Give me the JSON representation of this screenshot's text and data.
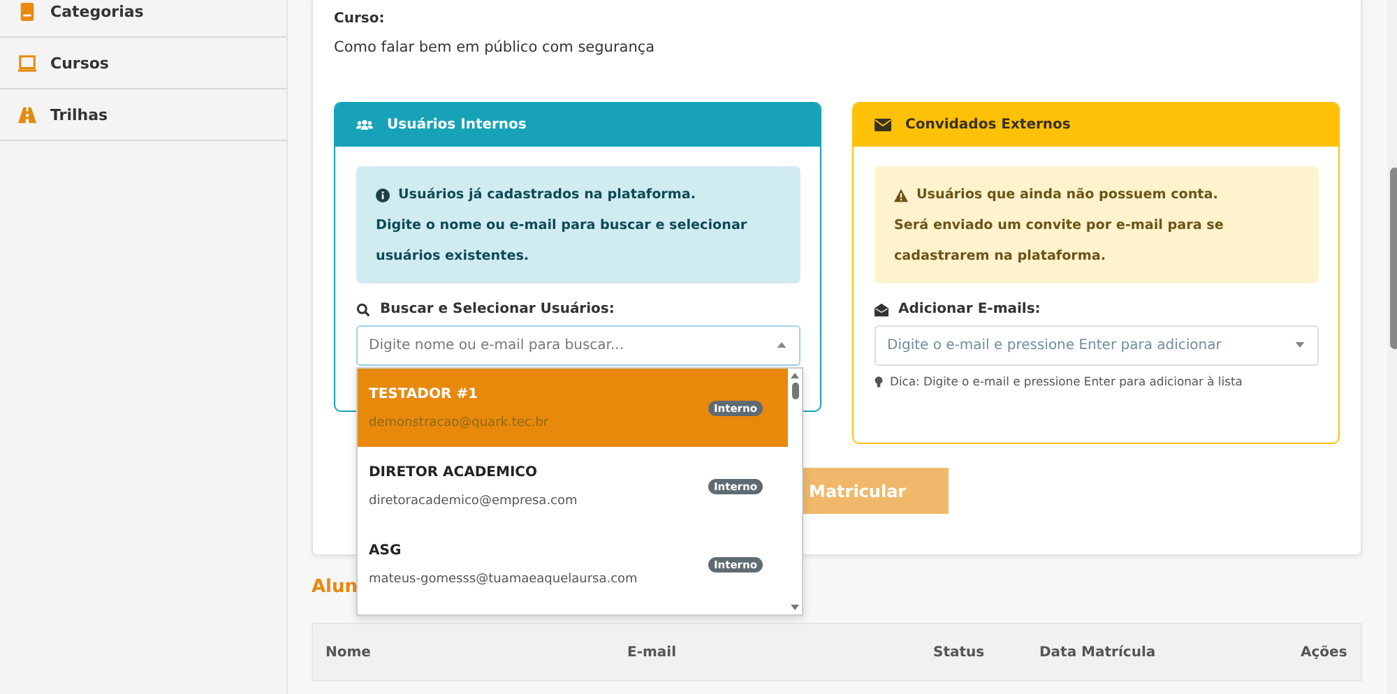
{
  "sidebar": {
    "items": [
      {
        "label": "Categorias",
        "kind": "book"
      },
      {
        "label": "Cursos",
        "kind": "monitor"
      },
      {
        "label": "Trilhas",
        "kind": "road"
      }
    ]
  },
  "course": {
    "label": "Curso:",
    "name": "Como falar bem em público com segurança"
  },
  "internal": {
    "title": "Usuários Internos",
    "info_title": "Usuários já cadastrados na plataforma.",
    "info_text": "Digite o nome ou e-mail para buscar e selecionar usuários existentes.",
    "field_label": "Buscar e Selecionar Usuários:",
    "placeholder": "Digite nome ou e-mail para buscar...",
    "expanded": true,
    "options": [
      {
        "name": "TESTADOR #1",
        "email": "demonstracao@quark.tec.br",
        "badge": "Interno",
        "selected": true
      },
      {
        "name": "DIRETOR ACADEMICO",
        "email": "diretoracademico@empresa.com",
        "badge": "Interno",
        "selected": false
      },
      {
        "name": "ASG",
        "email": "mateus-gomesss@tuamaeaquelaursa.com",
        "badge": "Interno",
        "selected": false
      }
    ]
  },
  "external": {
    "title": "Convidados Externos",
    "warning_title": "Usuários que ainda não possuem conta.",
    "warning_text": "Será enviado um convite por e-mail para se cadastrarem na plataforma.",
    "field_label": "Adicionar E-mails:",
    "placeholder": "Digite o e-mail e pressione Enter para adicionar",
    "hint": "Dica: Digite o e-mail e pressione Enter para adicionar à lista"
  },
  "submit": {
    "label": "Matricular",
    "disabled": true
  },
  "students": {
    "heading": "Alun",
    "columns": [
      "Nome",
      "E-mail",
      "Status",
      "Data Matrícula",
      "Ações"
    ]
  }
}
